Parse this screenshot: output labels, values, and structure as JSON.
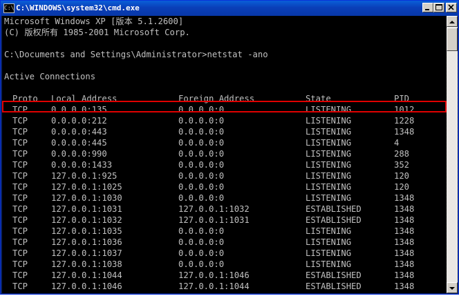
{
  "window": {
    "title": "C:\\WINDOWS\\system32\\cmd.exe",
    "icon": "cmd-icon",
    "title_icon_text": "C:\\"
  },
  "console": {
    "header_lines": [
      "Microsoft Windows XP [版本 5.1.2600]",
      "(C) 版权所有 1985-2001 Microsoft Corp.",
      "",
      "C:\\Documents and Settings\\Administrator>netstat -ano",
      "",
      "Active Connections",
      ""
    ],
    "columns": [
      "Proto",
      "Local Address",
      "Foreign Address",
      "State",
      "PID"
    ],
    "rows": [
      [
        "TCP",
        "0.0.0.0:135",
        "0.0.0.0:0",
        "LISTENING",
        "1012"
      ],
      [
        "TCP",
        "0.0.0.0:212",
        "0.0.0.0:0",
        "LISTENING",
        "1228"
      ],
      [
        "TCP",
        "0.0.0.0:443",
        "0.0.0.0:0",
        "LISTENING",
        "1348"
      ],
      [
        "TCP",
        "0.0.0.0:445",
        "0.0.0.0:0",
        "LISTENING",
        "4"
      ],
      [
        "TCP",
        "0.0.0.0:990",
        "0.0.0.0:0",
        "LISTENING",
        "288"
      ],
      [
        "TCP",
        "0.0.0.0:1433",
        "0.0.0.0:0",
        "LISTENING",
        "352"
      ],
      [
        "TCP",
        "127.0.0.1:925",
        "0.0.0.0:0",
        "LISTENING",
        "120"
      ],
      [
        "TCP",
        "127.0.0.1:1025",
        "0.0.0.0:0",
        "LISTENING",
        "120"
      ],
      [
        "TCP",
        "127.0.0.1:1030",
        "0.0.0.0:0",
        "LISTENING",
        "1348"
      ],
      [
        "TCP",
        "127.0.0.1:1031",
        "127.0.0.1:1032",
        "ESTABLISHED",
        "1348"
      ],
      [
        "TCP",
        "127.0.0.1:1032",
        "127.0.0.1:1031",
        "ESTABLISHED",
        "1348"
      ],
      [
        "TCP",
        "127.0.0.1:1035",
        "0.0.0.0:0",
        "LISTENING",
        "1348"
      ],
      [
        "TCP",
        "127.0.0.1:1036",
        "0.0.0.0:0",
        "LISTENING",
        "1348"
      ],
      [
        "TCP",
        "127.0.0.1:1037",
        "0.0.0.0:0",
        "LISTENING",
        "1348"
      ],
      [
        "TCP",
        "127.0.0.1:1038",
        "0.0.0.0:0",
        "LISTENING",
        "1348"
      ],
      [
        "TCP",
        "127.0.0.1:1044",
        "127.0.0.1:1046",
        "ESTABLISHED",
        "1348"
      ],
      [
        "TCP",
        "127.0.0.1:1046",
        "127.0.0.1:1044",
        "ESTABLISHED",
        "1348"
      ]
    ],
    "highlighted_row_index": 1,
    "text_color": "#c0c0c0",
    "background_color": "#000000",
    "highlight_color": "#e00000"
  },
  "controls": {
    "minimize_icon": "minimize-icon",
    "maximize_icon": "maximize-icon",
    "close_icon": "close-icon",
    "scroll_up_icon": "scroll-up-arrow-icon",
    "scroll_down_icon": "scroll-down-arrow-icon"
  }
}
